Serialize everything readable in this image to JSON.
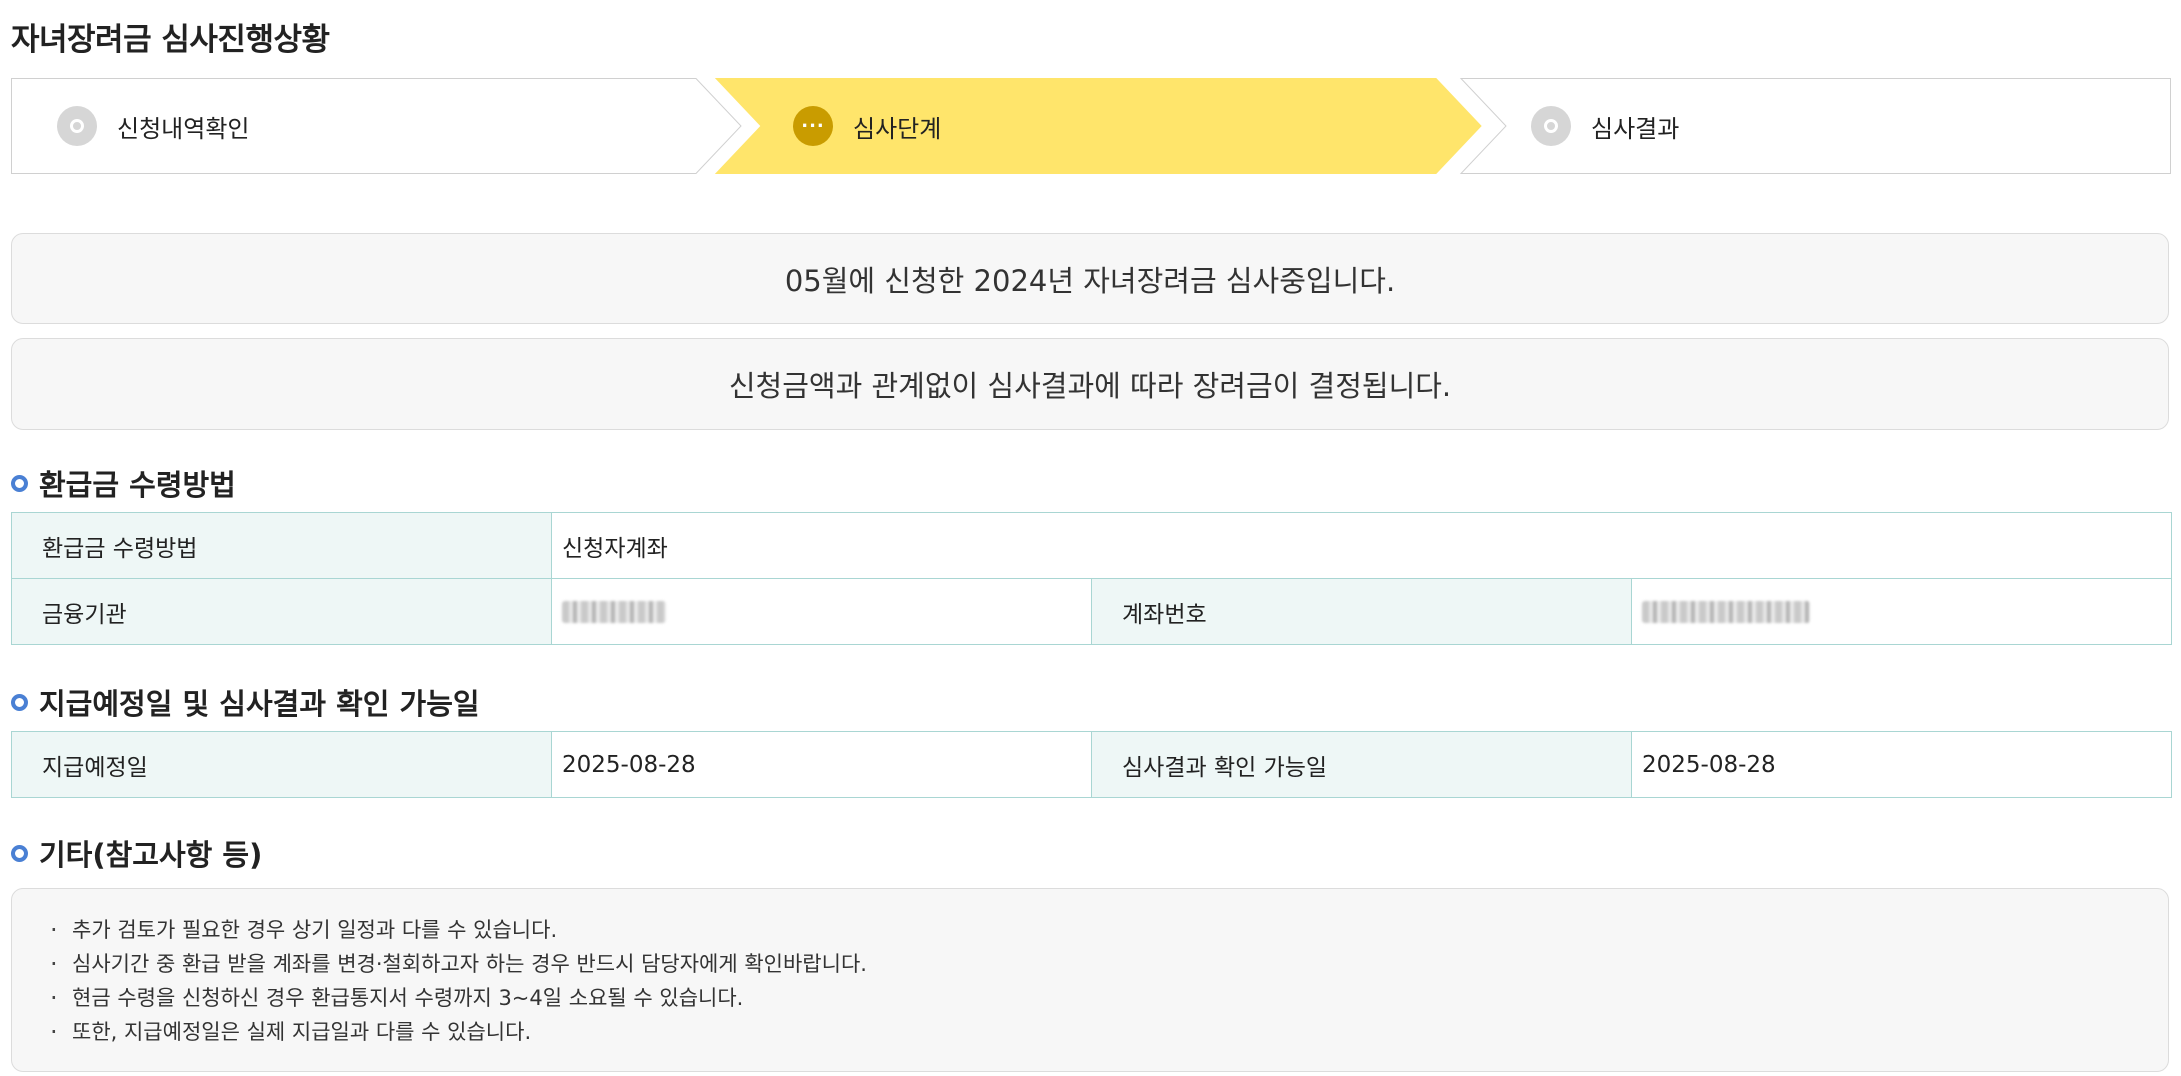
{
  "page": {
    "title": "자녀장려금 심사진행상황"
  },
  "stepper": {
    "steps": [
      {
        "label": "신청내역확인",
        "state": "done"
      },
      {
        "label": "심사단계",
        "state": "active"
      },
      {
        "label": "심사결과",
        "state": "pending"
      }
    ],
    "active_color": "#ffe56b",
    "active_dot_color": "#c99c00"
  },
  "notices": [
    "05월에 신청한 2024년 자녀장려금 심사중입니다.",
    "신청금액과 관계없이 심사결과에 따라 장려금이 결정됩니다."
  ],
  "refund_section": {
    "title": "환급금 수령방법",
    "rows": {
      "method_label": "환급금 수령방법",
      "method_value": "신청자계좌",
      "bank_label": "금융기관",
      "bank_value_masked": true,
      "account_label": "계좌번호",
      "account_value_masked": true
    }
  },
  "schedule_section": {
    "title": "지급예정일 및 심사결과 확인 가능일",
    "payment_date_label": "지급예정일",
    "payment_date_value": "2025-08-28",
    "result_date_label": "심사결과 확인 가능일",
    "result_date_value": "2025-08-28"
  },
  "notes_section": {
    "title": "기타(참고사항 등)",
    "items": [
      "추가 검토가 필요한 경우 상기 일정과 다를 수 있습니다.",
      "심사기간 중 환급 받을 계좌를 변경·철회하고자 하는 경우 반드시 담당자에게 확인바랍니다.",
      "현금 수령을 신청하신 경우 환급통지서 수령까지 3~4일 소요될 수 있습니다.",
      "또한, 지급예정일은 실제 지급일과 다를 수 있습니다."
    ]
  },
  "colors": {
    "section_bullet": "#4a80d4",
    "table_border": "#a9d6d3",
    "table_header_bg": "#eef7f6"
  }
}
